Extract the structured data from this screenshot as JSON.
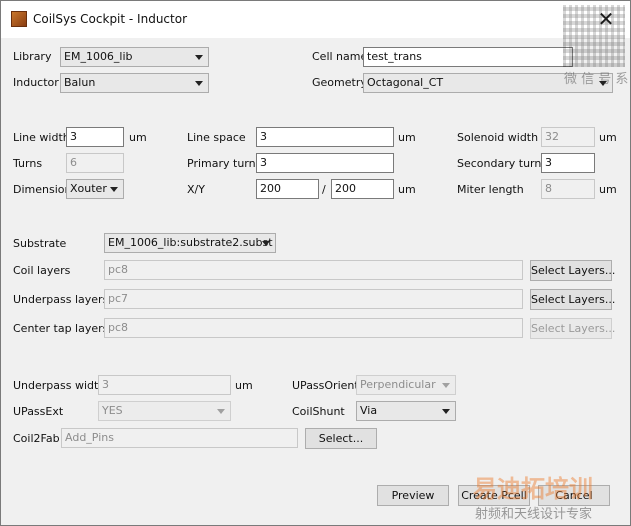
{
  "window": {
    "title": "CoilSys Cockpit - Inductor",
    "close_glyph": "✕"
  },
  "top": {
    "library_label": "Library",
    "library_value": "EM_1006_lib",
    "inductor_label": "Inductor",
    "inductor_value": "Balun",
    "cellname_label": "Cell name",
    "cellname_value": "test_trans",
    "geometry_label": "Geometry",
    "geometry_value": "Octagonal_CT"
  },
  "params": {
    "linewidth_label": "Line width",
    "linewidth_value": "3",
    "linewidth_unit": "um",
    "turns_label": "Turns",
    "turns_value": "6",
    "dimension_label": "Dimension",
    "dimension_value": "Xouter",
    "linespace_label": "Line space",
    "linespace_value": "3",
    "linespace_unit": "um",
    "primaryturns_label": "Primary turns",
    "primaryturns_value": "3",
    "xy_label": "X/Y",
    "x_value": "200",
    "xy_separator": "/",
    "y_value": "200",
    "xy_unit": "um",
    "solenoidwidth_label": "Solenoid width",
    "solenoidwidth_value": "32",
    "solenoidwidth_unit": "um",
    "secondaryturns_label": "Secondary turns",
    "secondaryturns_value": "3",
    "miterlength_label": "Miter length",
    "miterlength_value": "8",
    "miterlength_unit": "um"
  },
  "layers": {
    "substrate_label": "Substrate",
    "substrate_value": "EM_1006_lib:substrate2.subst",
    "coil_label": "Coil layers",
    "coil_value": "pc8",
    "underpass_label": "Underpass layers",
    "underpass_value": "pc7",
    "centertap_label": "Center tap layers",
    "centertap_value": "pc8",
    "select_layers_label": "Select Layers..."
  },
  "bottom": {
    "underpasswidth_label": "Underpass width",
    "underpasswidth_value": "3",
    "underpasswidth_unit": "um",
    "upassorient_label": "UPassOrient",
    "upassorient_value": "Perpendicular",
    "upassext_label": "UPassExt",
    "upassext_value": "YES",
    "coilshunt_label": "CoilShunt",
    "coilshunt_value": "Via",
    "coil2fab_label": "Coil2Fab",
    "coil2fab_placeholder": "Add_Pins",
    "select_label": "Select..."
  },
  "actions": {
    "preview": "Preview",
    "create_pcell": "Create Pcell",
    "cancel": "Cancel"
  },
  "watermarks": {
    "wechat": "微 信 号 系",
    "brand": "易迪拓培训",
    "subtitle": "射频和天线设计专家"
  }
}
